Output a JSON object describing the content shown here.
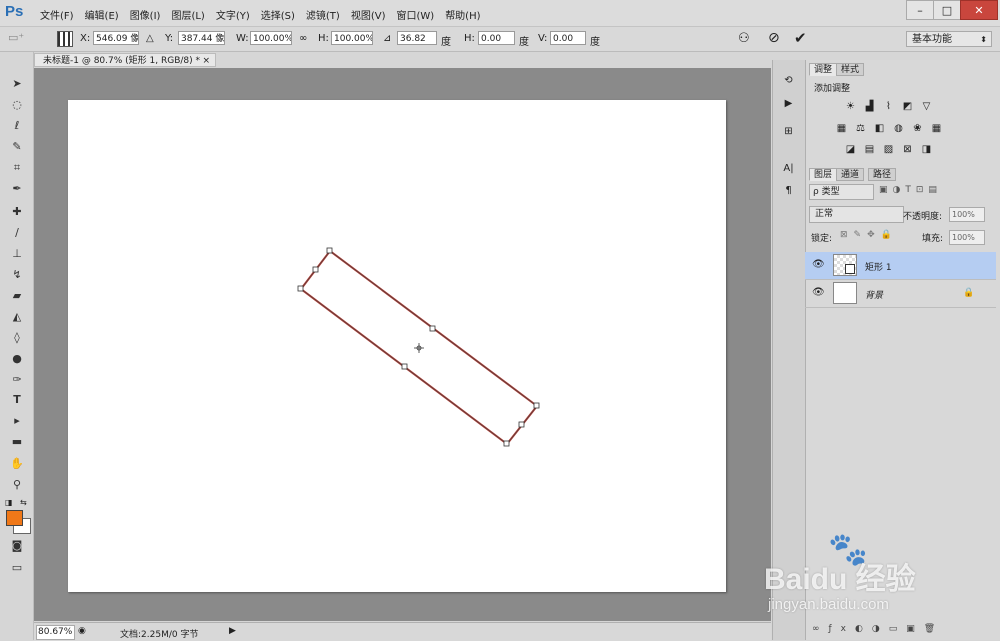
{
  "app": {
    "logo": "Ps",
    "menus": [
      "文件(F)",
      "编辑(E)",
      "图像(I)",
      "图层(L)",
      "文字(Y)",
      "选择(S)",
      "滤镜(T)",
      "视图(V)",
      "窗口(W)",
      "帮助(H)"
    ]
  },
  "window_controls": {
    "minimize": "–",
    "maximize": "□",
    "close": "✕"
  },
  "options": {
    "x_label": "X:",
    "x_value": "546.09 像",
    "y_label": "Y:",
    "y_value": "387.44 像",
    "w_label": "W:",
    "w_value": "100.00%",
    "h_label": "H:",
    "h_value": "100.00%",
    "angle_value": "36.82",
    "angle_unit": "度",
    "hskew_label": "H:",
    "hskew_value": "0.00",
    "hskew_unit": "度",
    "vskew_label": "V:",
    "vskew_value": "0.00",
    "vskew_unit": "度",
    "workspace": "基本功能"
  },
  "document": {
    "tab_title": "未标题-1 @ 80.7% (矩形 1, RGB/8) *",
    "tab_close": "×"
  },
  "status": {
    "zoom": "80.67%",
    "doc_info": "文档:2.25M/0 字节"
  },
  "colors": {
    "foreground": "#f07818",
    "background": "#ffffff",
    "shape_stroke": "#b03a32"
  },
  "adjustments_panel": {
    "tabs": [
      "调整",
      "样式"
    ],
    "title": "添加调整"
  },
  "layers_panel": {
    "tabs": [
      "图层",
      "通道",
      "路径"
    ],
    "filter": "ρ 类型",
    "blend_mode": "正常",
    "opacity_label": "不透明度:",
    "opacity_value": "100%",
    "lock_label": "锁定:",
    "fill_label": "填充:",
    "fill_value": "100%",
    "layers": [
      {
        "name": "矩形 1",
        "selected": true
      },
      {
        "name": "背景",
        "selected": false,
        "locked": true
      }
    ]
  },
  "watermark": {
    "brand": "Baidu 经验",
    "url": "jingyan.baidu.com"
  }
}
